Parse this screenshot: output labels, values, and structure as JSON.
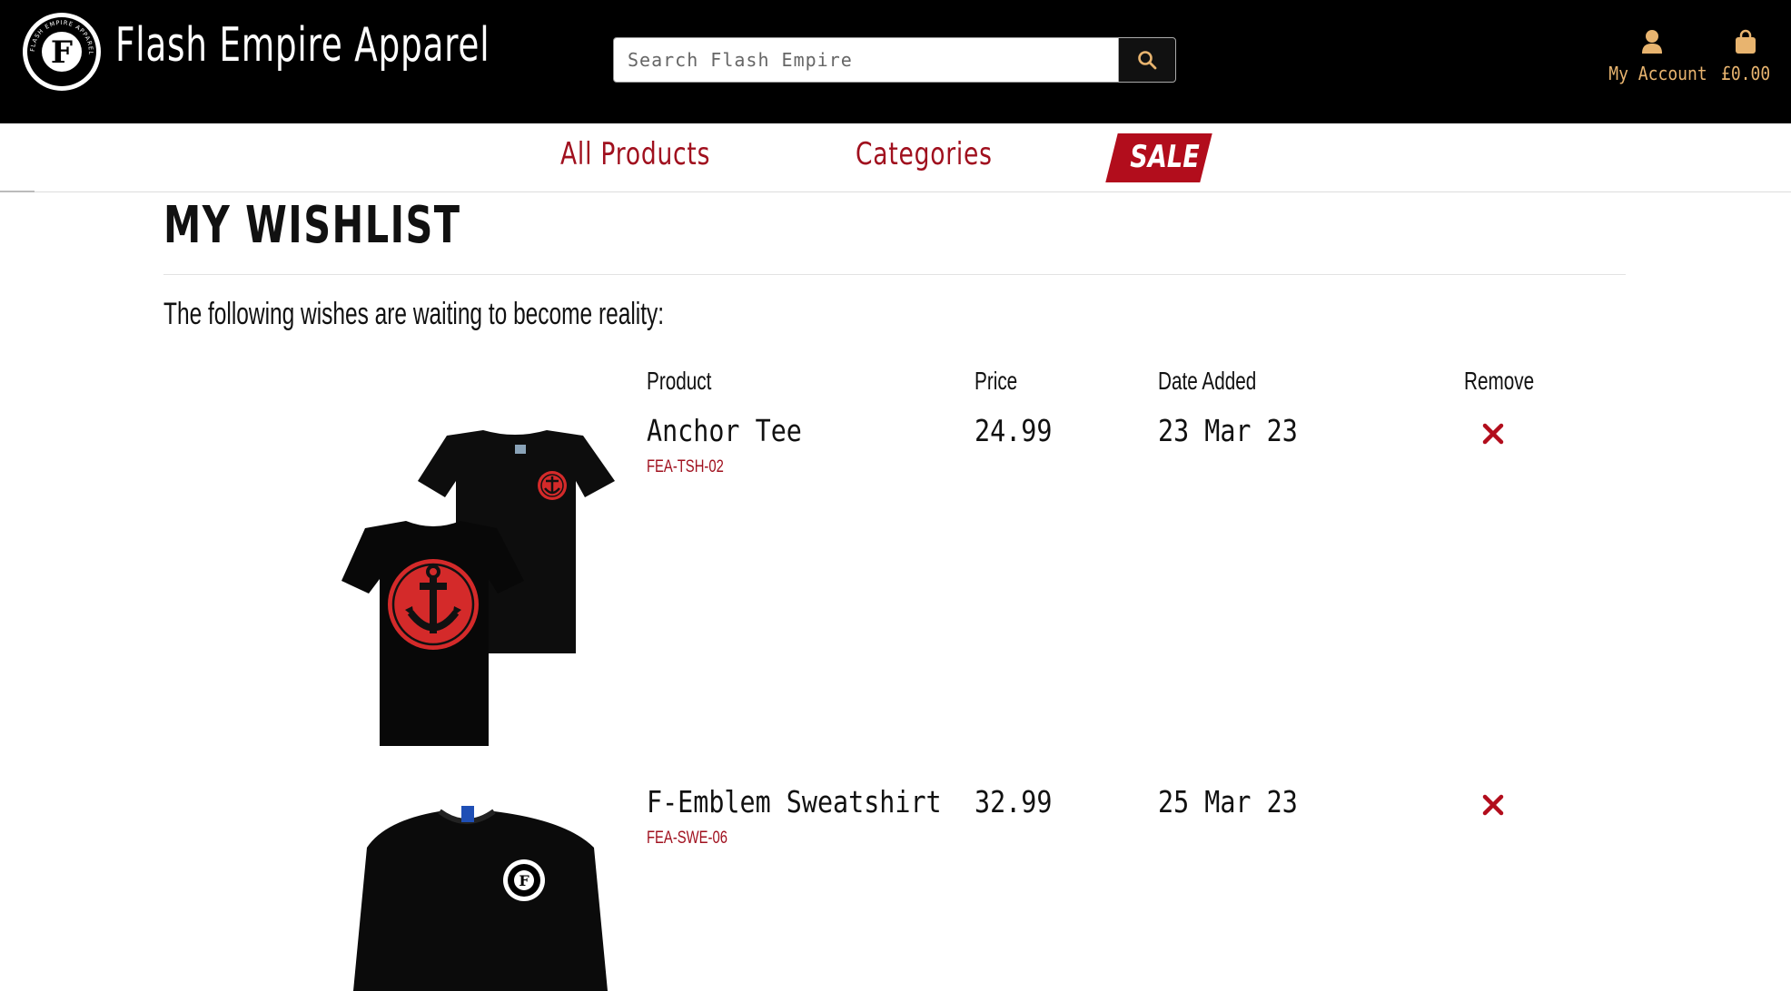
{
  "header": {
    "brand": "Flash Empire Apparel",
    "logo_text": "FLASH EMPIRE APPAREL",
    "search_placeholder": "Search Flash Empire",
    "account_label": "My Account",
    "cart_total": "£0.00",
    "accent_color": "#e8b46f"
  },
  "nav": {
    "all_products": "All Products",
    "categories": "Categories",
    "sale": "SALE"
  },
  "wishlist": {
    "title": "MY WISHLIST",
    "intro": "The following wishes are waiting to become reality:",
    "columns": {
      "product": "Product",
      "price": "Price",
      "date_added": "Date Added",
      "remove": "Remove"
    },
    "items": [
      {
        "name": "Anchor Tee",
        "sku": "FEA-TSH-02",
        "price": "24.99",
        "date_added": "23 Mar 23"
      },
      {
        "name": "F-Emblem Sweatshirt",
        "sku": "FEA-SWE-06",
        "price": "32.99",
        "date_added": "25 Mar 23"
      }
    ]
  },
  "colors": {
    "brand_red": "#a0101e",
    "header_bg": "#000000"
  }
}
